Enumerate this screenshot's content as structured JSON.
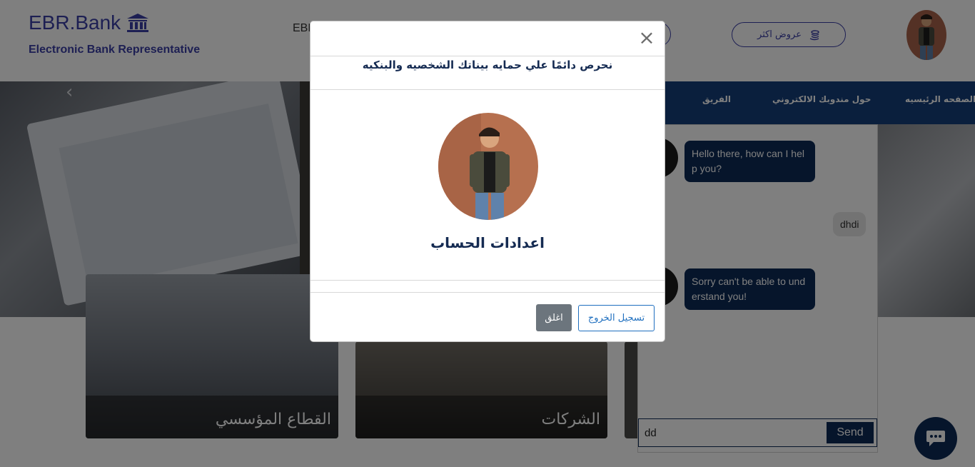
{
  "header": {
    "brand": "EBR.Bank",
    "brand_icon": "bank-icon",
    "subtitle": "Electronic Bank Representative",
    "nav_partial": "EBR",
    "offers_label": "عروض اكثر",
    "offers_icon": "coins-icon"
  },
  "navbar": {
    "items": [
      "الصفحه الرئيسيه",
      "حول مندوبك الالكتروني",
      "الفريق"
    ]
  },
  "cards": [
    {
      "label": "القطاع المؤسسي"
    },
    {
      "label": "الشركات"
    }
  ],
  "chat": {
    "messages": [
      {
        "from": "bot",
        "text": "Hello there, how can I help you?"
      },
      {
        "from": "user",
        "text": "dhdi"
      },
      {
        "from": "bot",
        "text": "Sorry can't be able to understand you!"
      }
    ],
    "input_value": "dd",
    "send_label": "Send"
  },
  "modal": {
    "title": "نحرص دائمًا علي حمايه بيناتك الشخصيه والبنكيه",
    "heading": "اعدادات الحساب",
    "close_icon": "close-icon",
    "logout_label": "تسجيل الخروج",
    "close_label": "اغلق"
  },
  "colors": {
    "brand": "#3b3fa6",
    "navy": "#0d2a56",
    "navbar": "#153f7b",
    "secondary_button": "#6c757d",
    "link_blue": "#1f6fbf"
  }
}
